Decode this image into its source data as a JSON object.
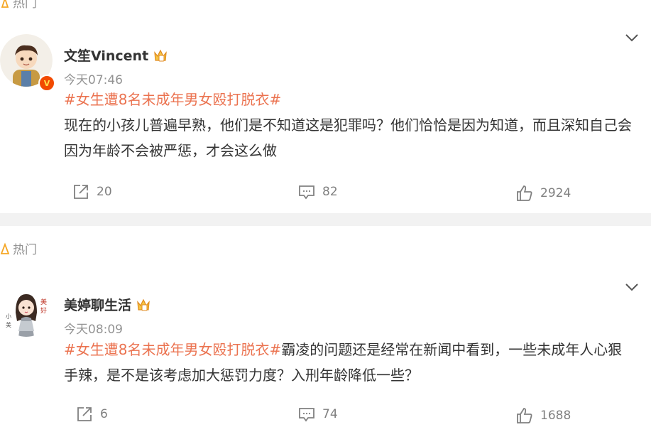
{
  "hot_label": "热门",
  "posts": [
    {
      "username": "文笙Vincent",
      "timestamp": "今天07:46",
      "hashtag": "#女生遭8名未成年男女殴打脱衣#",
      "text": "现在的小孩儿普遍早熟，他们是不知道这是犯罪吗？他们恰恰是因为知道，而且深知自己会因为年龄不会被严惩，才会这么做",
      "repost_count": "20",
      "comment_count": "82",
      "like_count": "2924",
      "verified_badge": "V"
    },
    {
      "username": "美婷聊生活",
      "timestamp": "今天08:09",
      "hashtag": "#女生遭8名未成年男女殴打脱衣#",
      "text": "霸凌的问题还是经常在新闻中看到，一些未成年人心狠手辣，是不是该考虑加大惩罚力度？入刑年龄降低一些？",
      "repost_count": "6",
      "comment_count": "74",
      "like_count": "1688"
    }
  ],
  "colors": {
    "hashtag": "#eb7350",
    "meta": "#939393",
    "badge": "#f24a00",
    "crown": "#f5a623",
    "divider": "#f2f2f2"
  },
  "icons": {
    "repost": "repost-icon",
    "comment": "comment-icon",
    "like": "like-icon",
    "more": "chevron-down-icon",
    "hot": "fire-icon",
    "member": "crown-icon"
  }
}
